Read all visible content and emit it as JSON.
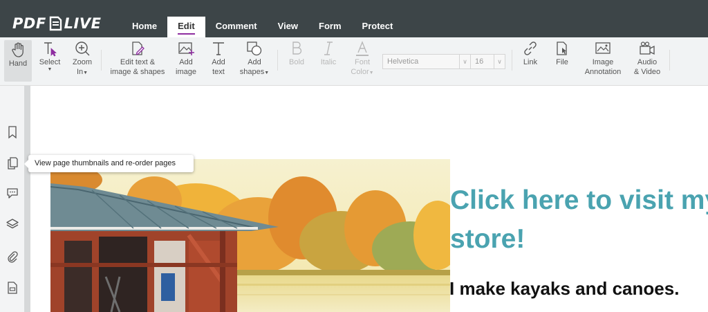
{
  "app": {
    "logo_left": "PDF",
    "logo_right": "LIVE"
  },
  "nav": {
    "tabs": [
      {
        "label": "Home"
      },
      {
        "label": "Edit"
      },
      {
        "label": "Comment"
      },
      {
        "label": "View"
      },
      {
        "label": "Form"
      },
      {
        "label": "Protect"
      }
    ],
    "active_tab": "Edit"
  },
  "toolbar": {
    "hand": "Hand",
    "select": "Select",
    "zoom_in": [
      "Zoom",
      "In"
    ],
    "edit_text": [
      "Edit text &",
      "image & shapes"
    ],
    "add_image": [
      "Add",
      "image"
    ],
    "add_text": [
      "Add",
      "text"
    ],
    "add_shapes": [
      "Add",
      "shapes"
    ],
    "bold": "Bold",
    "italic": "Italic",
    "font_color": [
      "Font",
      "Color"
    ],
    "font_family": "Helvetica",
    "font_size": "16",
    "link": "Link",
    "file": "File",
    "image_annotation": [
      "Image",
      "Annotation"
    ],
    "audio_video": [
      "Audio",
      "& Video"
    ]
  },
  "sidebar": {
    "tooltip": "View page thumbnails and re-order pages"
  },
  "document": {
    "headline_line1": "Click here to visit my",
    "headline_line2": "store!",
    "subline": "I make kayaks and canoes."
  },
  "colors": {
    "topbar": "#3d4548",
    "accent": "#8e2da0",
    "headline": "#4aa3b0"
  }
}
